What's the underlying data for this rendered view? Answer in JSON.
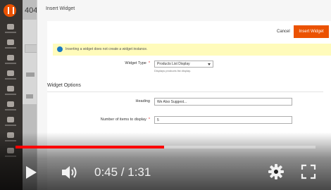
{
  "admin": {
    "page_title": "404",
    "sidebar_items": [
      "Dashboard",
      "Sales",
      "Products",
      "Customers",
      "Marketing",
      "Content",
      "Reports",
      "Stores",
      "System"
    ]
  },
  "modal": {
    "title": "Insert Widget",
    "cancel_label": "Cancel",
    "insert_label": "Insert Widget",
    "notice": "Inserting a widget does not create a widget instance.",
    "widget_type_label": "Widget Type",
    "widget_type_value": "Products List Display",
    "widget_type_note": "Displays products list display.",
    "section_title": "Widget Options",
    "heading_label": "Heading",
    "heading_value": "We Also Suggest...",
    "count_label": "Number of items to display",
    "count_value": "5"
  },
  "player": {
    "current_time": "0:45",
    "duration": "1:31",
    "time_display": "0:45 / 1:31",
    "progress_fraction": 0.4945,
    "accent_color": "#ff0000"
  }
}
